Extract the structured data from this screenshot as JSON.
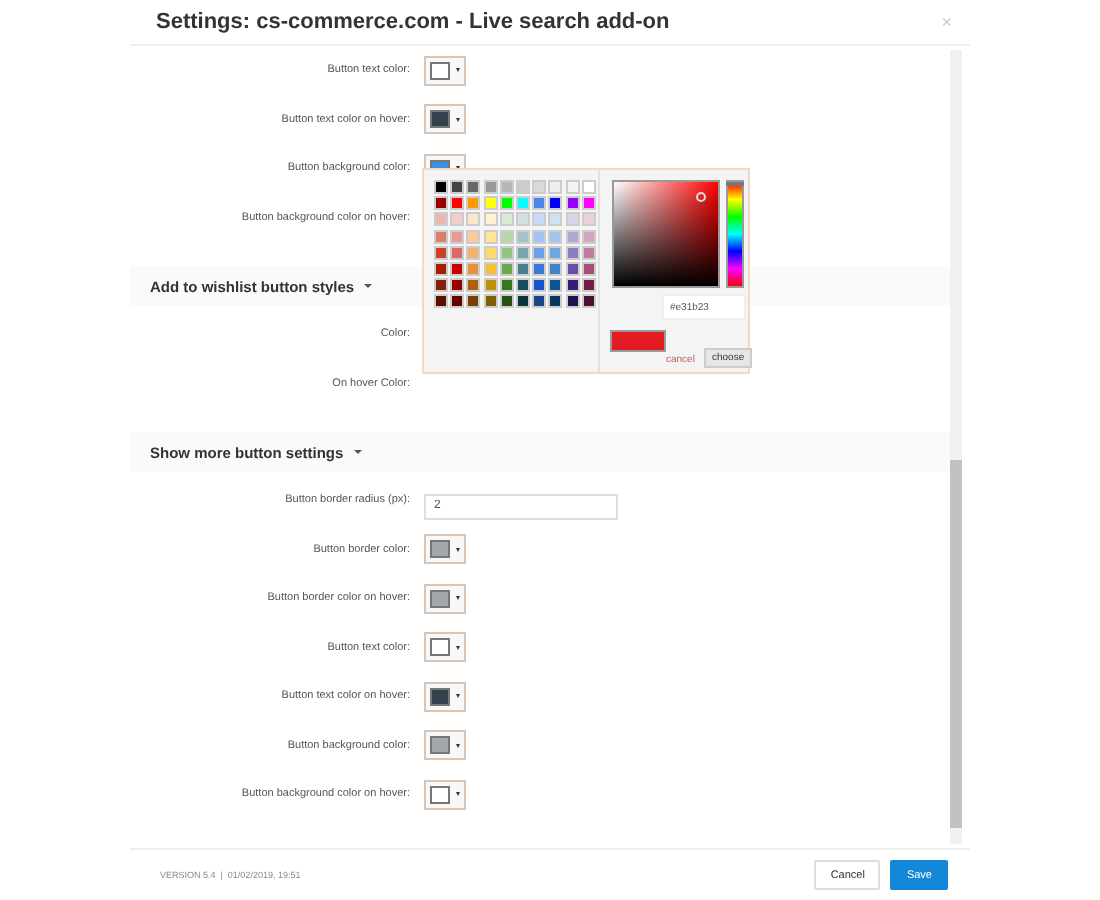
{
  "window": {
    "title": "Settings: cs-commerce.com - Live search add-on",
    "close": "×"
  },
  "sections": [
    {
      "fields": [
        {
          "kind": "color",
          "label": "Button text color:",
          "color": "#ffffff"
        },
        {
          "kind": "color",
          "label": "Button text color on hover:",
          "color": "#34404b"
        },
        {
          "kind": "color",
          "label": "Button background color:",
          "color": "#3b8ee0",
          "picker_open": true
        },
        {
          "kind": "label",
          "label": "Button background color on hover:"
        }
      ]
    },
    {
      "title": "Add to wishlist button styles",
      "fields": [
        {
          "kind": "label",
          "label": "Color:"
        },
        {
          "kind": "label",
          "label": "On hover Color:"
        }
      ]
    },
    {
      "title": "Show more button settings",
      "fields": [
        {
          "kind": "text",
          "label": "Button border radius (px):",
          "value": "2"
        },
        {
          "kind": "color",
          "label": "Button border color:",
          "color": "#a3a8ad"
        },
        {
          "kind": "color",
          "label": "Button border color on hover:",
          "color": "#a3a8ad"
        },
        {
          "kind": "color",
          "label": "Button text color:",
          "color": "#ffffff"
        },
        {
          "kind": "color",
          "label": "Button text color on hover:",
          "color": "#34404b"
        },
        {
          "kind": "color",
          "label": "Button background color:",
          "color": "#a3a8ad"
        },
        {
          "kind": "color",
          "label": "Button background color on hover:",
          "color": "#ffffff"
        }
      ]
    }
  ],
  "picker": {
    "palette": [
      [
        {
          "color": "#000000"
        },
        {
          "color": "#444444"
        },
        {
          "color": "#666666"
        },
        {
          "color": "#999999"
        },
        {
          "color": "#b7b7b7"
        },
        {
          "color": "#cccccc"
        },
        {
          "color": "#d9d9d9"
        },
        {
          "color": "#efefef"
        },
        {
          "color": "#f3f3f3"
        },
        {
          "color": "#ffffff"
        }
      ],
      [
        {
          "color": "#980000"
        },
        {
          "color": "#ff0000"
        },
        {
          "color": "#ff9900"
        },
        {
          "color": "#ffff00"
        },
        {
          "color": "#00ff00"
        },
        {
          "color": "#00ffff"
        },
        {
          "color": "#4a86e8"
        },
        {
          "color": "#0000ff"
        },
        {
          "color": "#9900ff"
        },
        {
          "color": "#ff00ff"
        }
      ],
      [
        {
          "color": "#e6b8af"
        },
        {
          "color": "#f4cccc"
        },
        {
          "color": "#fce5cd"
        },
        {
          "color": "#fff2cc"
        },
        {
          "color": "#d9ead3"
        },
        {
          "color": "#d0e0e3"
        },
        {
          "color": "#c9daf8"
        },
        {
          "color": "#cfe2f3"
        },
        {
          "color": "#d9d2e9"
        },
        {
          "color": "#ead1dc"
        }
      ],
      [
        {
          "color": "#dd7e6b"
        },
        {
          "color": "#ea9999"
        },
        {
          "color": "#f9cb9c"
        },
        {
          "color": "#ffe599"
        },
        {
          "color": "#b6d7a8"
        },
        {
          "color": "#a2c4c9"
        },
        {
          "color": "#a4c2f4"
        },
        {
          "color": "#9fc5e8"
        },
        {
          "color": "#b4a7d6"
        },
        {
          "color": "#d5a6bd"
        }
      ],
      [
        {
          "color": "#cc4125"
        },
        {
          "color": "#e06666"
        },
        {
          "color": "#f6b26b"
        },
        {
          "color": "#ffd966"
        },
        {
          "color": "#93c47d"
        },
        {
          "color": "#76a5af"
        },
        {
          "color": "#6d9eeb"
        },
        {
          "color": "#6fa8dc"
        },
        {
          "color": "#8e7cc3"
        },
        {
          "color": "#c27ba0"
        }
      ],
      [
        {
          "color": "#a61c00"
        },
        {
          "color": "#cc0000"
        },
        {
          "color": "#e69138"
        },
        {
          "color": "#f1c232"
        },
        {
          "color": "#6aa84f"
        },
        {
          "color": "#45818e"
        },
        {
          "color": "#3c78d8"
        },
        {
          "color": "#3d85c6"
        },
        {
          "color": "#674ea7"
        },
        {
          "color": "#a64d79"
        }
      ],
      [
        {
          "color": "#85200c"
        },
        {
          "color": "#990000"
        },
        {
          "color": "#b45f06"
        },
        {
          "color": "#bf9000"
        },
        {
          "color": "#38761d"
        },
        {
          "color": "#134f5c"
        },
        {
          "color": "#1155cc"
        },
        {
          "color": "#0b5394"
        },
        {
          "color": "#351c75"
        },
        {
          "color": "#741b47"
        }
      ],
      [
        {
          "color": "#5b0f00"
        },
        {
          "color": "#660000"
        },
        {
          "color": "#783f04"
        },
        {
          "color": "#7f6000"
        },
        {
          "color": "#274e13"
        },
        {
          "color": "#0c343d"
        },
        {
          "color": "#1c4587"
        },
        {
          "color": "#073763"
        },
        {
          "color": "#20124d"
        },
        {
          "color": "#4c1130"
        }
      ]
    ],
    "hue": {
      "level": 0
    },
    "value": "#e31b23",
    "cancel": "cancel",
    "choose": "choose"
  },
  "footer": {
    "version": "VERSION 5.4  |  01/02/2019, 19:51",
    "cancel": "Cancel",
    "save": "Save"
  }
}
